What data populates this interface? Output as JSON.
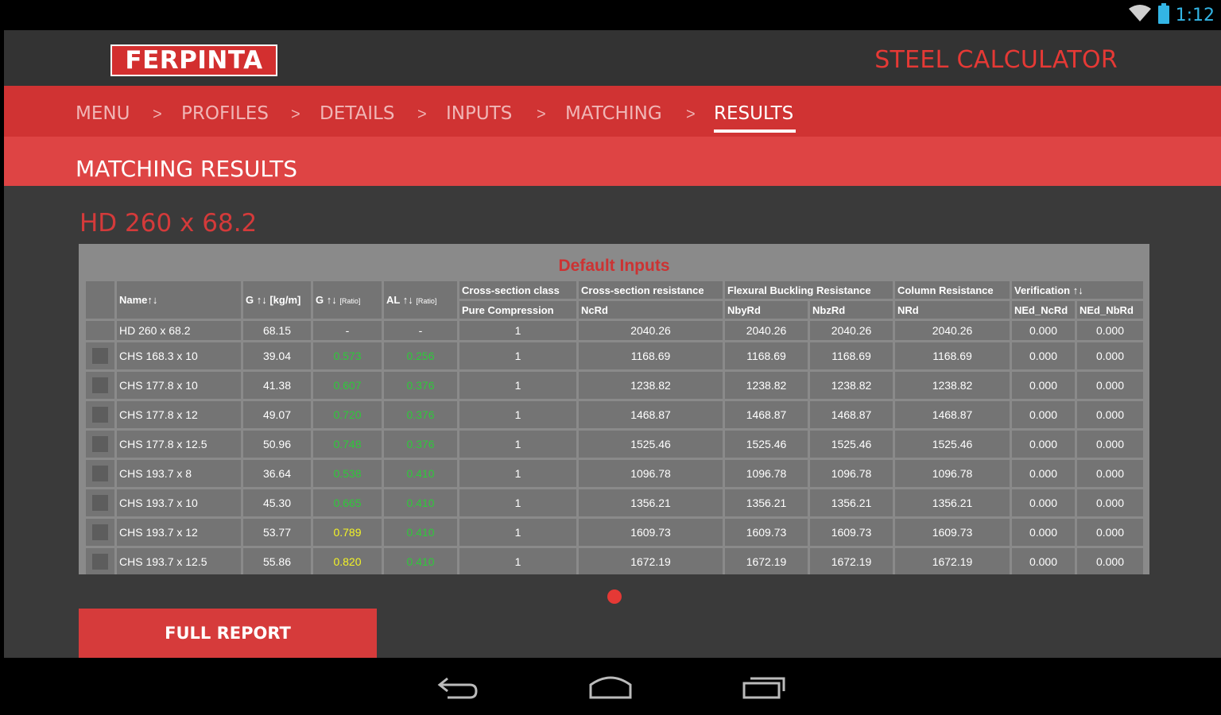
{
  "status_bar": {
    "time": "1:12"
  },
  "header": {
    "logo_text": "FERPINTA",
    "app_title": "STEEL CALCULATOR"
  },
  "breadcrumb": {
    "items": [
      "MENU",
      "PROFILES",
      "DETAILS",
      "INPUTS",
      "MATCHING",
      "RESULTS"
    ],
    "separator": ">",
    "active": "RESULTS"
  },
  "section_title": "MATCHING RESULTS",
  "profile_title": "HD 260 x 68.2",
  "table": {
    "heading": "Default Inputs",
    "header_row1": [
      "Name↑↓",
      "G ↑↓ [kg/m]",
      "G ↑↓",
      "AL ↑↓",
      "Cross-section class",
      "Cross-section resistance",
      "Flexural Buckling Resistance",
      "Column Resistance",
      "Verification ↑↓"
    ],
    "header_units": {
      "g_ratio": "[Ratio]",
      "al_ratio": "[Ratio]"
    },
    "header_row2": [
      "Pure Compression",
      "NcRd",
      "NbyRd",
      "NbzRd",
      "NRd",
      "NEd_NcRd",
      "NEd_NbRd"
    ],
    "reference_row": [
      "HD 260 x 68.2",
      "68.15",
      "-",
      "-",
      "1",
      "2040.26",
      "2040.26",
      "2040.26",
      "2040.26",
      "0.000",
      "0.000"
    ],
    "rows": [
      [
        "CHS 168.3 x 10",
        "39.04",
        "0.573",
        "0.256",
        "1",
        "1168.69",
        "1168.69",
        "1168.69",
        "1168.69",
        "0.000",
        "0.000"
      ],
      [
        "CHS 177.8 x 10",
        "41.38",
        "0.607",
        "0.376",
        "1",
        "1238.82",
        "1238.82",
        "1238.82",
        "1238.82",
        "0.000",
        "0.000"
      ],
      [
        "CHS 177.8 x 12",
        "49.07",
        "0.720",
        "0.376",
        "1",
        "1468.87",
        "1468.87",
        "1468.87",
        "1468.87",
        "0.000",
        "0.000"
      ],
      [
        "CHS 177.8 x 12.5",
        "50.96",
        "0.748",
        "0.376",
        "1",
        "1525.46",
        "1525.46",
        "1525.46",
        "1525.46",
        "0.000",
        "0.000"
      ],
      [
        "CHS 193.7 x 8",
        "36.64",
        "0.538",
        "0.410",
        "1",
        "1096.78",
        "1096.78",
        "1096.78",
        "1096.78",
        "0.000",
        "0.000"
      ],
      [
        "CHS 193.7 x 10",
        "45.30",
        "0.665",
        "0.410",
        "1",
        "1356.21",
        "1356.21",
        "1356.21",
        "1356.21",
        "0.000",
        "0.000"
      ],
      [
        "CHS 193.7 x 12",
        "53.77",
        "0.789",
        "0.410",
        "1",
        "1609.73",
        "1609.73",
        "1609.73",
        "1609.73",
        "0.000",
        "0.000"
      ],
      [
        "CHS 193.7 x 12.5",
        "55.86",
        "0.820",
        "0.410",
        "1",
        "1672.19",
        "1672.19",
        "1672.19",
        "1672.19",
        "0.000",
        "0.000"
      ]
    ],
    "g_ratio_colors": [
      "green",
      "green",
      "green",
      "green",
      "green",
      "green",
      "yellow",
      "yellow"
    ],
    "highlight_colors": {
      "green": "#2ec93a",
      "yellow": "#f3f325"
    }
  },
  "full_report_label": "FULL REPORT",
  "colors": {
    "brand_red": "#d32f2f",
    "background": "#3a3a3a",
    "table_bg": "#8a8a8a"
  }
}
